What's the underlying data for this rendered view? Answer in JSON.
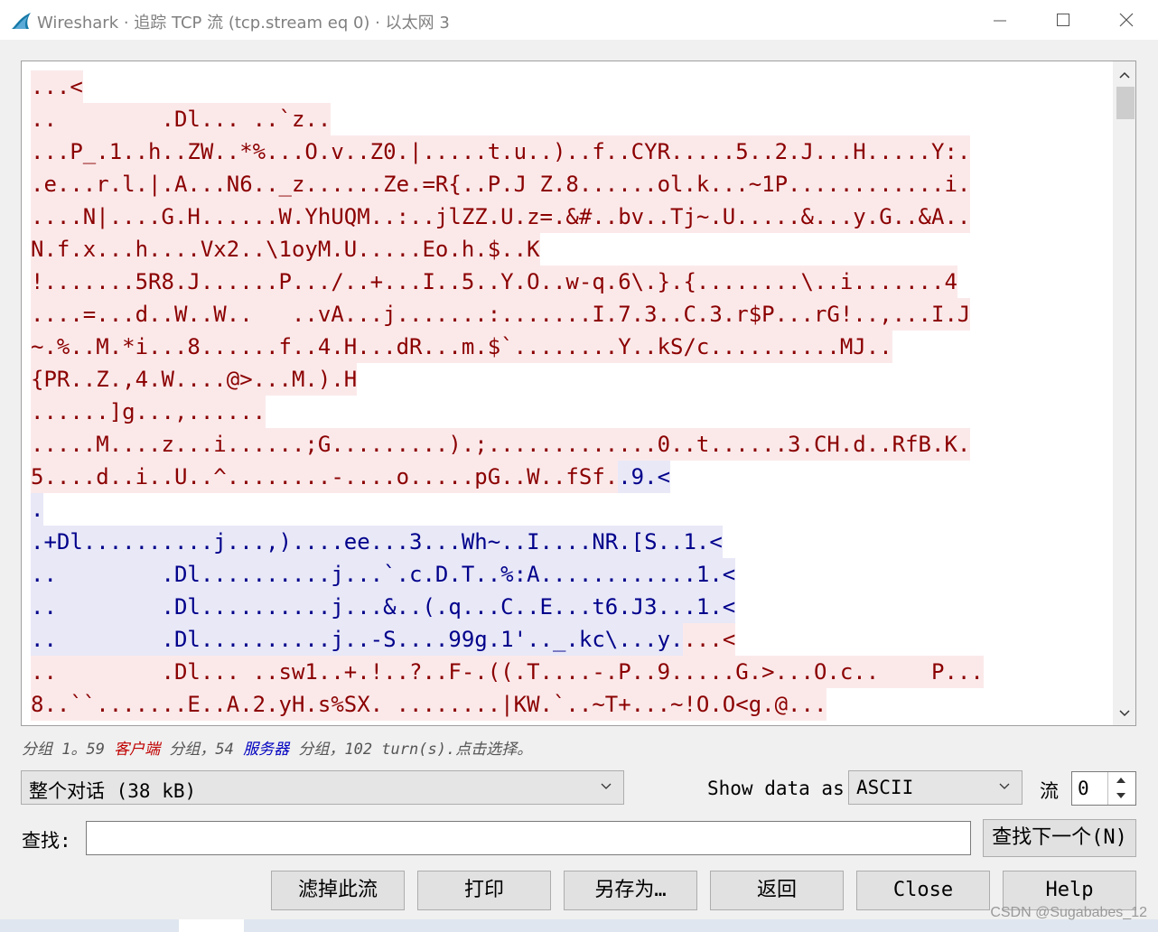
{
  "window": {
    "title": "Wireshark · 追踪 TCP 流 (tcp.stream eq 0) · 以太网 3",
    "controls": [
      "minimize",
      "maximize",
      "close"
    ]
  },
  "stream": {
    "lines": [
      [
        {
          "d": "c",
          "t": "...<"
        }
      ],
      [
        {
          "d": "c",
          "t": "..        .Dl... ..`z.."
        }
      ],
      [
        {
          "d": "c",
          "t": "...P_.1..h..ZW..*%...O.v..Z0.|.....t.u..)..f..CYR.....5..2.J...H.....Y:."
        }
      ],
      [
        {
          "d": "c",
          "t": ".e...r.l.|.A...N6.._z......Ze.=R{..P.J Z.8......ol.k...~1P............i."
        }
      ],
      [
        {
          "d": "c",
          "t": "....N|....G.H......W.YhUQM..:..jlZZ.U.z=.&#..bv..Tj~.U.....&...y.G..&A.."
        }
      ],
      [
        {
          "d": "c",
          "t": "N.f.x...h....Vx2..\\1oyM.U.....Eo.h.$..K"
        }
      ],
      [
        {
          "d": "c",
          "t": "!.......5R8.J......P.../..+...I..5..Y.O..w-q.6\\.}.{........\\..i.......4"
        }
      ],
      [
        {
          "d": "c",
          "t": "....=...d..W..W..   ..vA...j.......:.......I.7.3..C.3.r$P...rG!..,...I.J"
        }
      ],
      [
        {
          "d": "c",
          "t": "~.%..M.*i...8......f..4.H...dR...m.$`........Y..kS/c..........MJ.."
        }
      ],
      [
        {
          "d": "c",
          "t": "{PR..Z.,4.W....@>...M.).H"
        }
      ],
      [
        {
          "d": "c",
          "t": "......]g...,......"
        }
      ],
      [
        {
          "d": "c",
          "t": ".....M....z...i......;G.........).;.............0..t......3.CH.d..RfB.K."
        }
      ],
      [
        {
          "d": "c",
          "t": "5....d..i..U..^........-....o.....pG..W..fSf."
        },
        {
          "d": "s",
          "t": ".9.<"
        }
      ],
      [
        {
          "d": "s",
          "t": "."
        }
      ],
      [
        {
          "d": "s",
          "t": ".+Dl..........j...,)....ee...3...Wh~..I....NR.[S..1.<"
        }
      ],
      [
        {
          "d": "s",
          "t": "..        .Dl..........j...`.c.D.T..%:A............1.<"
        }
      ],
      [
        {
          "d": "s",
          "t": "..        .Dl..........j...&..(.q...C..E...t6.J3...1.<"
        }
      ],
      [
        {
          "d": "s",
          "t": "..        .Dl..........j..-S....99g.1'.._.kc\\...y."
        },
        {
          "d": "c",
          "t": "...<"
        }
      ],
      [
        {
          "d": "c",
          "t": "..        .Dl... ..sw1..+.!..?..F-.((.T....-.P..9.....G.>...O.c..    P..."
        }
      ],
      [
        {
          "d": "c",
          "t": "8..``.......E..A.2.yH.s%SX. ........|KW.`..~T+...~!O.O<g.@..."
        }
      ],
      [
        {
          "d": "c",
          "t": ""
        }
      ]
    ]
  },
  "status": {
    "part1": "分组 1。59 ",
    "client": "客户端",
    "part2": " 分组，54 ",
    "server": "服务器",
    "part3": " 分组，102 turn(s).点击选择。"
  },
  "conversation": {
    "value": "整个对话 (38 kB)"
  },
  "show_data": {
    "label": "Show data as",
    "value": "ASCII"
  },
  "stream_index": {
    "label": "流",
    "value": "0"
  },
  "find": {
    "label": "查找:",
    "value": "",
    "next_button": "查找下一个(N)"
  },
  "buttons": {
    "filter_out": "滤掉此流",
    "print": "打印",
    "save_as": "另存为…",
    "back": "返回",
    "close": "Close",
    "help": "Help"
  },
  "watermark": "CSDN @Sugababes_12",
  "colors": {
    "client_bg": "#fbe9ea",
    "client_fg": "#8b0000",
    "server_bg": "#e8e8f7",
    "server_fg": "#00008b"
  }
}
